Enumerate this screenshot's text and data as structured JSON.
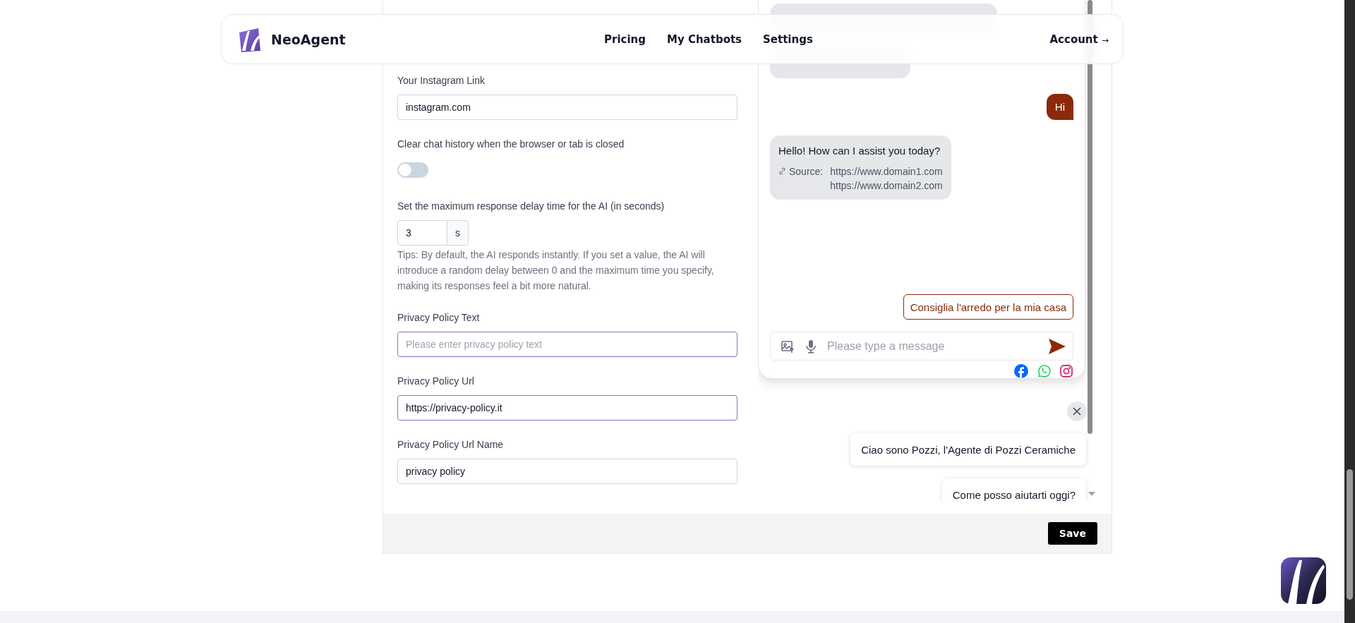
{
  "header": {
    "brand": "NeoAgent",
    "nav": [
      {
        "label": "Pricing"
      },
      {
        "label": "My Chatbots"
      },
      {
        "label": "Settings"
      }
    ],
    "account": {
      "label": "Account",
      "arrow": "→"
    }
  },
  "form": {
    "fields": [
      {
        "kind": "text",
        "label": "Your Instagram Link",
        "value": "instagram.com",
        "focused": false
      },
      {
        "kind": "toggle",
        "label": "Clear chat history when the browser or tab is closed",
        "on": false
      },
      {
        "kind": "number",
        "label": "Set the maximum response delay time for the AI (in seconds)",
        "value": "3",
        "unit": "s",
        "tip": "Tips: By default, the AI responds instantly. If you set a value, the AI will introduce a random delay between 0 and the maximum time you specify, making its responses feel a bit more natural."
      },
      {
        "kind": "text",
        "label": "Privacy Policy Text",
        "placeholder": "Please enter privacy policy text",
        "focused": true
      },
      {
        "kind": "text",
        "label": "Privacy Policy Url",
        "value": "https://privacy-policy.it",
        "focused": true
      },
      {
        "kind": "text",
        "label": "Privacy Policy Url Name",
        "value": "privacy policy",
        "focused": false
      }
    ]
  },
  "save_button": "Save",
  "chat": {
    "messages": [
      {
        "kind": "bot",
        "obscured": true
      },
      {
        "kind": "bot",
        "obscured": true
      },
      {
        "kind": "user",
        "text": "Hi"
      },
      {
        "kind": "bot",
        "text": "Hello! How can I assist you today?",
        "source_label": "Source:",
        "sources": [
          "https://www.domain1.com",
          "https://www.domain2.com"
        ]
      }
    ],
    "suggestion": "Consiglia l'arredo per la mia casa",
    "input": {
      "placeholder": "Please type a message"
    }
  },
  "greetings": [
    "Ciao sono Pozzi, l'Agente di Pozzi Ceramiche",
    "Come posso aiutarti oggi?"
  ]
}
